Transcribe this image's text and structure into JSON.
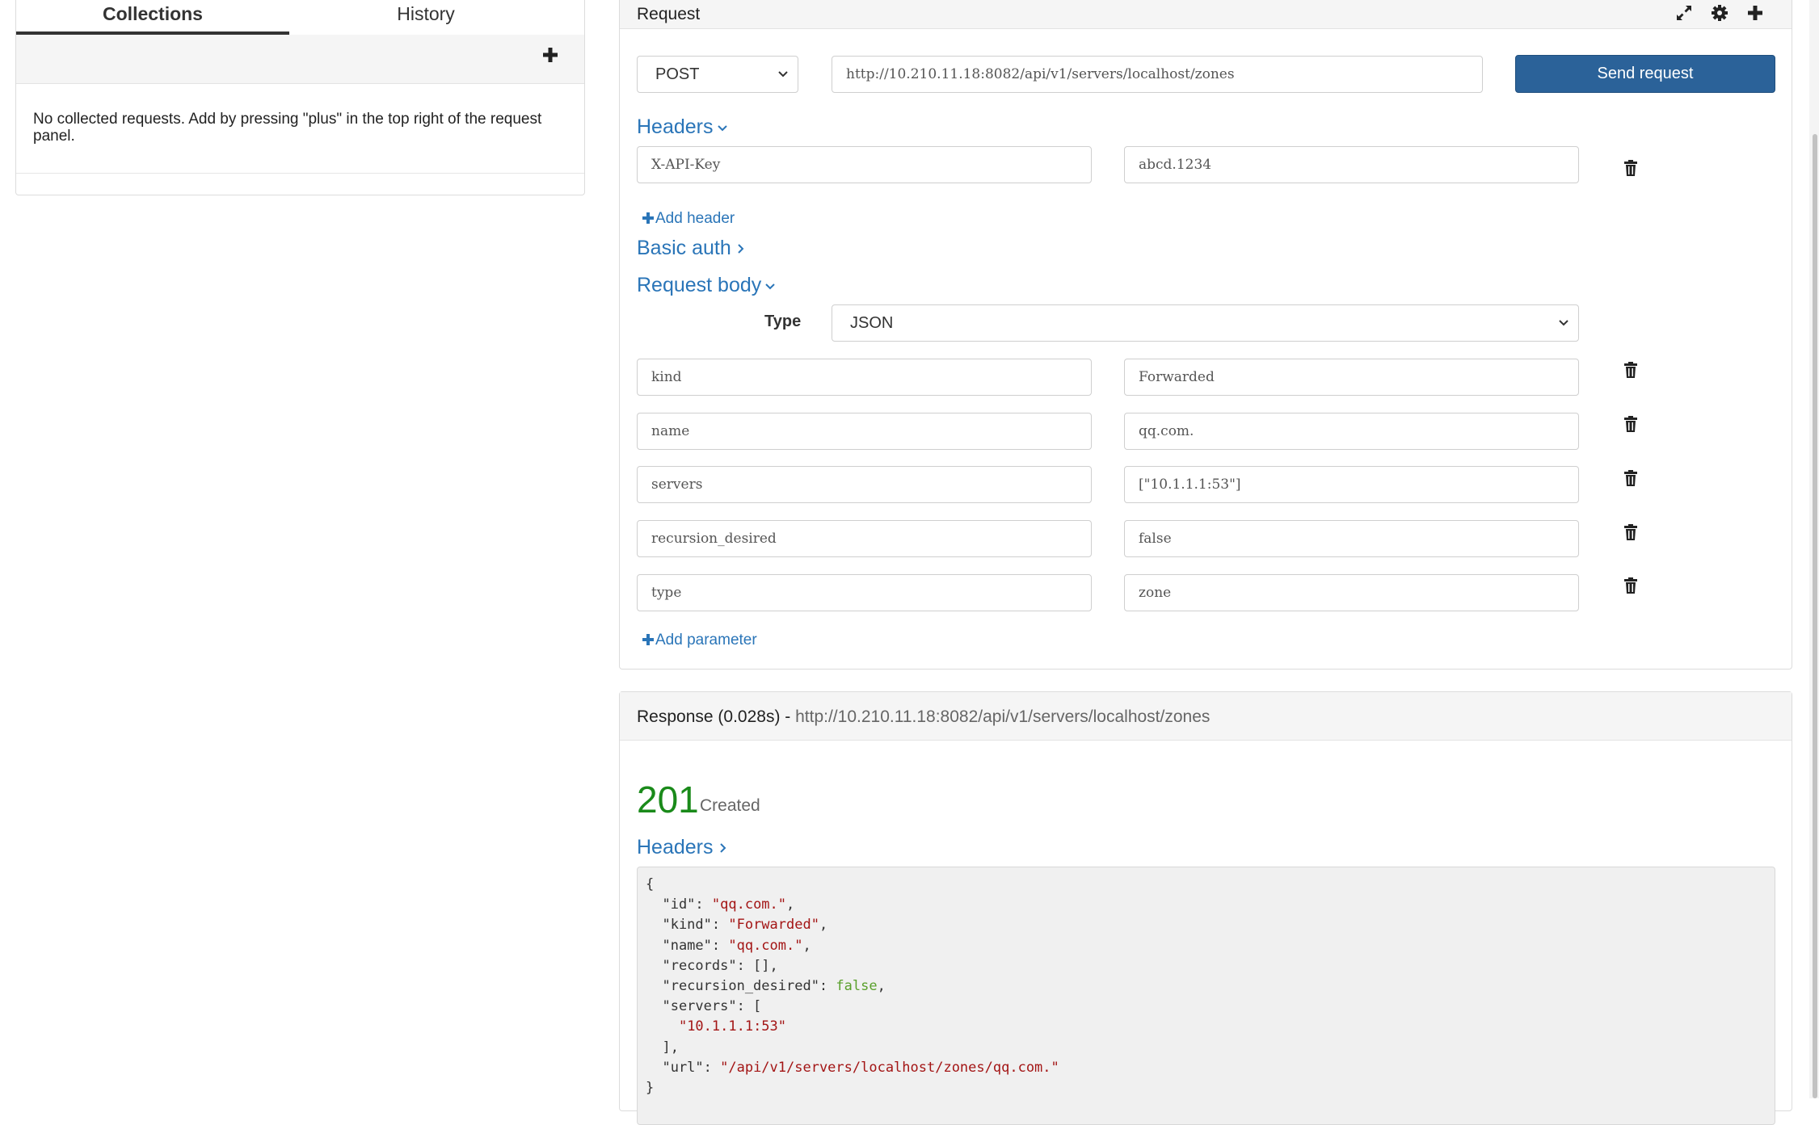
{
  "left": {
    "tabs": [
      "Collections",
      "History"
    ],
    "empty_message": "No collected requests. Add by pressing \"plus\" in the top right of the request panel."
  },
  "request": {
    "title": "Request",
    "method": "POST",
    "url": "http://10.210.11.18:8082/api/v1/servers/localhost/zones",
    "send_label": "Send request",
    "headers_label": "Headers",
    "headers": [
      {
        "key": "X-API-Key",
        "value": "abcd.1234"
      }
    ],
    "add_header_label": "Add header",
    "basic_auth_label": "Basic auth",
    "body_label": "Request body",
    "type_label": "Type",
    "body_type": "JSON",
    "params": [
      {
        "key": "kind",
        "value": "Forwarded"
      },
      {
        "key": "name",
        "value": "qq.com."
      },
      {
        "key": "servers",
        "value": "[\"10.1.1.1:53\"]"
      },
      {
        "key": "recursion_desired",
        "value": "false"
      },
      {
        "key": "type",
        "value": "zone"
      }
    ],
    "add_param_label": "Add parameter"
  },
  "response": {
    "title": "Response (0.028s) - ",
    "url": "http://10.210.11.18:8082/api/v1/servers/localhost/zones",
    "status_code": "201",
    "status_text": "Created",
    "headers_label": "Headers",
    "json_lines": [
      [
        {
          "t": "{",
          "c": "k"
        }
      ],
      [
        {
          "t": "  \"id\": ",
          "c": "k"
        },
        {
          "t": "\"qq.com.\"",
          "c": "s"
        },
        {
          "t": ",",
          "c": "k"
        }
      ],
      [
        {
          "t": "  \"kind\": ",
          "c": "k"
        },
        {
          "t": "\"Forwarded\"",
          "c": "s"
        },
        {
          "t": ",",
          "c": "k"
        }
      ],
      [
        {
          "t": "  \"name\": ",
          "c": "k"
        },
        {
          "t": "\"qq.com.\"",
          "c": "s"
        },
        {
          "t": ",",
          "c": "k"
        }
      ],
      [
        {
          "t": "  \"records\": [],",
          "c": "k"
        }
      ],
      [
        {
          "t": "  \"recursion_desired\": ",
          "c": "k"
        },
        {
          "t": "false",
          "c": "b"
        },
        {
          "t": ",",
          "c": "k"
        }
      ],
      [
        {
          "t": "  \"servers\": [",
          "c": "k"
        }
      ],
      [
        {
          "t": "    ",
          "c": "k"
        },
        {
          "t": "\"10.1.1.1:53\"",
          "c": "s"
        }
      ],
      [
        {
          "t": "  ],",
          "c": "k"
        }
      ],
      [
        {
          "t": "  \"url\": ",
          "c": "k"
        },
        {
          "t": "\"/api/v1/servers/localhost/zones/qq.com.\"",
          "c": "s"
        }
      ],
      [
        {
          "t": "}",
          "c": "k"
        }
      ]
    ]
  },
  "colors": {
    "link": "#2a75b8",
    "send_button": "#2b6299",
    "status_success": "#1a8a1a",
    "json_string": "#a31515",
    "json_boolean": "#5aa02c"
  },
  "icons": [
    "plus-icon",
    "expand-icon",
    "gear-icon",
    "chevron-down-icon",
    "chevron-right-icon",
    "trash-icon"
  ]
}
